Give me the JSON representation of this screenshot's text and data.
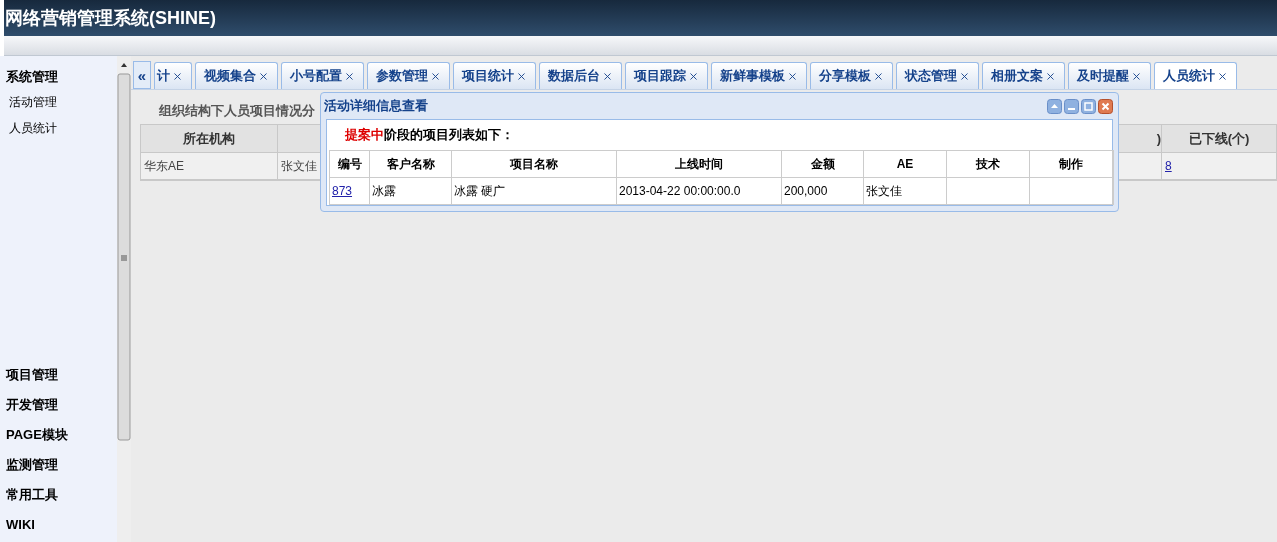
{
  "header": {
    "title": "网络营销管理系统(SHINE)"
  },
  "sidebar": {
    "sections": [
      {
        "label": "系统管理",
        "items": [
          {
            "label": "活动管理"
          },
          {
            "label": "人员统计"
          }
        ]
      },
      {
        "label": "项目管理"
      },
      {
        "label": "开发管理"
      },
      {
        "label": "PAGE模块"
      },
      {
        "label": "监测管理"
      },
      {
        "label": "常用工具"
      },
      {
        "label": "WIKI"
      }
    ]
  },
  "tab_scroll": {
    "label": "«"
  },
  "tabs": [
    {
      "label": "计",
      "selected": false
    },
    {
      "label": "视频集合",
      "selected": false
    },
    {
      "label": "小号配置",
      "selected": false
    },
    {
      "label": "参数管理",
      "selected": false
    },
    {
      "label": "项目统计",
      "selected": false
    },
    {
      "label": "数据后台",
      "selected": false
    },
    {
      "label": "项目跟踪",
      "selected": false
    },
    {
      "label": "新鲜事模板",
      "selected": false
    },
    {
      "label": "分享模板",
      "selected": false
    },
    {
      "label": "状态管理",
      "selected": false
    },
    {
      "label": "相册文案",
      "selected": false
    },
    {
      "label": "及时提醒",
      "selected": false
    },
    {
      "label": "人员统计",
      "selected": true
    }
  ],
  "content": {
    "subtitle": "组织结构下人员项目情况分",
    "table": {
      "columns": [
        {
          "label": "所在机构"
        },
        {},
        {
          "label": ")"
        },
        {
          "label": "已下线(个)"
        }
      ],
      "rows": [
        [
          {
            "text": "华东AE"
          },
          {
            "text": "张文佳"
          },
          {},
          {
            "text": "8",
            "kind": "link"
          }
        ]
      ]
    }
  },
  "dialog": {
    "title": "活动详细信息查看",
    "caption": {
      "highlight": "提案中",
      "text": "阶段的项目列表如下："
    },
    "table": {
      "columns": [
        "编号",
        "客户名称",
        "项目名称",
        "上线时间",
        "金额",
        "AE",
        "技术",
        "制作"
      ],
      "rows": [
        [
          {
            "text": "873",
            "kind": "link"
          },
          {
            "text": "冰露"
          },
          {
            "text": "冰露 硬广"
          },
          {
            "text": "2013-04-22 00:00:00.0"
          },
          {
            "text": "200,000"
          },
          {
            "text": "张文佳"
          },
          {},
          {}
        ]
      ]
    }
  }
}
